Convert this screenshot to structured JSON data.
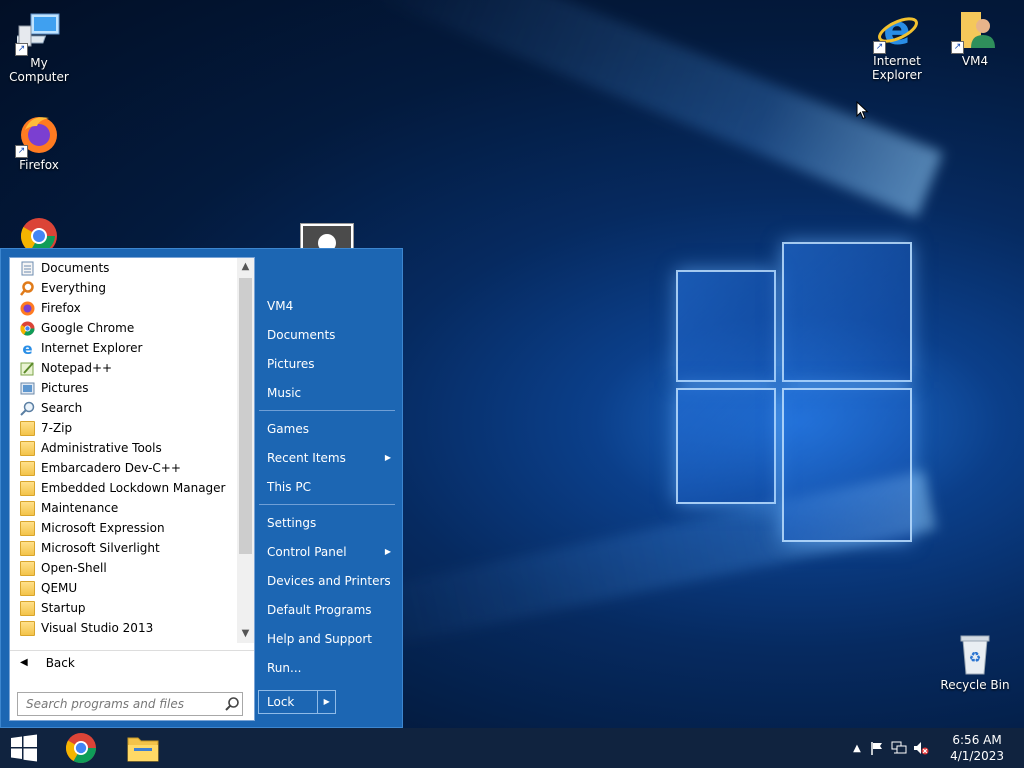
{
  "desktop": {
    "icons": [
      {
        "label": "My Computer",
        "icon": "computer-icon"
      },
      {
        "label": "Firefox",
        "icon": "firefox-icon"
      },
      {
        "label": "Internet Explorer",
        "icon": "internet-explorer-icon"
      },
      {
        "label": "VM4",
        "icon": "user-folder-icon"
      },
      {
        "label": "Recycle Bin",
        "icon": "recycle-bin-icon"
      },
      {
        "label": "",
        "icon": "chrome-icon"
      }
    ]
  },
  "start_menu": {
    "programs": [
      {
        "label": "Documents",
        "icon": "documents-icon"
      },
      {
        "label": "Everything",
        "icon": "everything-search-icon"
      },
      {
        "label": "Firefox",
        "icon": "firefox-icon"
      },
      {
        "label": "Google Chrome",
        "icon": "chrome-icon"
      },
      {
        "label": "Internet Explorer",
        "icon": "internet-explorer-icon"
      },
      {
        "label": "Notepad++",
        "icon": "notepad-plus-plus-icon"
      },
      {
        "label": "Pictures",
        "icon": "pictures-icon"
      },
      {
        "label": "Search",
        "icon": "search-icon"
      },
      {
        "label": "7-Zip",
        "icon": "folder-icon"
      },
      {
        "label": "Administrative Tools",
        "icon": "folder-icon"
      },
      {
        "label": "Embarcadero Dev-C++",
        "icon": "folder-icon"
      },
      {
        "label": "Embedded Lockdown Manager",
        "icon": "folder-icon"
      },
      {
        "label": "Maintenance",
        "icon": "folder-icon"
      },
      {
        "label": "Microsoft Expression",
        "icon": "folder-icon"
      },
      {
        "label": "Microsoft Silverlight",
        "icon": "folder-icon"
      },
      {
        "label": "Open-Shell",
        "icon": "folder-icon"
      },
      {
        "label": "QEMU",
        "icon": "folder-icon"
      },
      {
        "label": "Startup",
        "icon": "folder-icon"
      },
      {
        "label": "Visual Studio 2013",
        "icon": "folder-icon"
      }
    ],
    "back_label": "Back",
    "search_placeholder": "Search programs and files",
    "user_name": "VM4",
    "right_items": [
      {
        "label": "VM4",
        "submenu": false
      },
      {
        "label": "Documents",
        "submenu": false
      },
      {
        "label": "Pictures",
        "submenu": false
      },
      {
        "label": "Music",
        "submenu": false
      },
      {
        "label": "Games",
        "submenu": false
      },
      {
        "label": "Recent Items",
        "submenu": true
      },
      {
        "label": "This PC",
        "submenu": false
      },
      {
        "label": "Settings",
        "submenu": false
      },
      {
        "label": "Control Panel",
        "submenu": true
      },
      {
        "label": "Devices and Printers",
        "submenu": false
      },
      {
        "label": "Default Programs",
        "submenu": false
      },
      {
        "label": "Help and Support",
        "submenu": false
      },
      {
        "label": "Run...",
        "submenu": false
      }
    ],
    "lock_label": "Lock",
    "colors": {
      "menu_bg": "#1c66b3",
      "programs_bg": "#ffffff"
    }
  },
  "taskbar": {
    "pinned": [
      {
        "name": "start-button",
        "icon": "windows-logo-icon"
      },
      {
        "name": "chrome-taskbar-button",
        "icon": "chrome-icon"
      },
      {
        "name": "file-explorer-taskbar-button",
        "icon": "file-explorer-icon"
      }
    ],
    "tray_icons": [
      "show-hidden-icons-chevron-icon",
      "action-center-flag-icon",
      "network-icon",
      "volume-muted-icon"
    ],
    "time": "6:56 AM",
    "date": "4/1/2023",
    "color": "#10233f"
  }
}
